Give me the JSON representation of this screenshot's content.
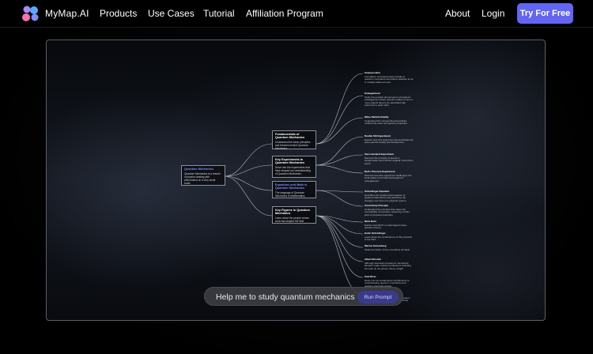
{
  "header": {
    "brand": "MyMap.AI",
    "nav": [
      "Products",
      "Use Cases",
      "Tutorial",
      "Affiliation Program"
    ],
    "about": "About",
    "login": "Login",
    "cta": "Try For Free"
  },
  "colors": {
    "accent": "#6366f1",
    "link_blue": "#7b8cff"
  },
  "map": {
    "root": {
      "title": "Quantum Mechanics",
      "desc": "Quantum Mechanics is a branch of physics dealing with phenomena on a very small scale."
    },
    "branches": [
      {
        "title": "Fundamentals of Quantum Mechanics",
        "desc": "Understand the basic principles and theories behind Quantum Mechanics."
      },
      {
        "title": "Key Experiments in Quantum Mechanics",
        "desc": "Delve into the experiments that have shaped our understanding of Quantum Mechanics."
      },
      {
        "title": "Equations and Math in Quantum Mechanics",
        "desc": "The language of Quantum Mechanics is Mathematics."
      },
      {
        "title": "Key Figures in Quantum Mechanics",
        "desc": "Learn about the people whose work has shaped the field."
      }
    ],
    "leaves": [
      {
        "title": "Superposition",
        "desc": "Foundation of fundamental principle of quantum mechanics that allows particles to be in multiple states at once."
      },
      {
        "title": "Entanglement",
        "desc": "Study the peculiar phenomenon of quantum entanglement where quantum states of two or more objects have to be described with reference to each other."
      },
      {
        "title": "Wave-Particle Duality",
        "desc": "Understand the concept that all particles exhibit both wave and particle properties."
      },
      {
        "title": "Double Slit Experiment",
        "desc": "Explore how this experiment demonstrates the wave-particle duality and interference."
      },
      {
        "title": "Stern-Gerlach Experiment",
        "desc": "Discover the principle of quantum superposition and intrinsic angular momentum (spin)."
      },
      {
        "title": "Bell's Theorem Experiment",
        "desc": "Discover how this experiment challenges the local realism and reinforced quantum entanglement."
      },
      {
        "title": "Schrödinger Equation",
        "desc": "Describes the fundamental equation of Quantum Mechanics that describes the changes over time of a physical system."
      },
      {
        "title": "Uncertainty Principle",
        "desc": "Understand the principle that states the impossibility of precisely measuring certain pairs of physical properties."
      },
      {
        "title": "Niels Bohr",
        "desc": "Explore how Bohr's model helped shape quantum theory."
      },
      {
        "title": "Erwin Schrödinger",
        "desc": "Learn about the contributions of this physicist to the field."
      },
      {
        "title": "Werner Heisenberg",
        "desc": "Study the father of the uncertainty principle."
      },
      {
        "title": "Albert Einstein",
        "desc": "Although skeptical of quantum mechanics, Einstein made critical contributions including his work on the photon theory of light."
      },
      {
        "title": "Paul Dirac",
        "desc": "Delve into his fundamental contributions to understanding quantum mechanics and quantum electrodynamics."
      },
      {
        "title": "Max Planck",
        "desc": "Planck is considered the father of Quantum Mechanics due to his work on black-body radiation."
      }
    ],
    "prompt": {
      "text": "Help me to study quantum mechanics",
      "button": "Run Prompt"
    }
  }
}
